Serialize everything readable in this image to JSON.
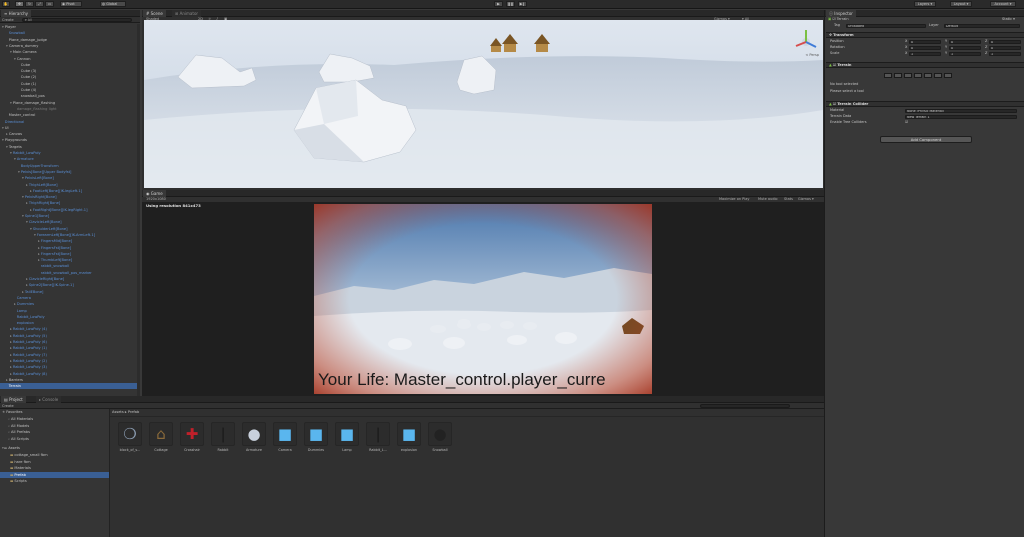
{
  "toolbar": {
    "pivot_label": "Pivot",
    "global_label": "Global",
    "layers_label": "Layers",
    "layout_label": "Layout",
    "account_label": "Account"
  },
  "hierarchy": {
    "tab": "Hierarchy",
    "create_label": "Create",
    "search_label": "▾ All",
    "items": [
      {
        "label": "Player",
        "depth": 0,
        "color": "normal",
        "arrow": "open"
      },
      {
        "label": "Snowball",
        "depth": 1,
        "color": "blue",
        "arrow": ""
      },
      {
        "label": "Plane_damage_judge",
        "depth": 1,
        "color": "normal",
        "arrow": ""
      },
      {
        "label": "Camera_dummy",
        "depth": 1,
        "color": "normal",
        "arrow": "open"
      },
      {
        "label": "Main Camera",
        "depth": 2,
        "color": "normal",
        "arrow": "open"
      },
      {
        "label": "Cannon",
        "depth": 3,
        "color": "normal",
        "arrow": "open"
      },
      {
        "label": "Cube",
        "depth": 4,
        "color": "normal",
        "arrow": ""
      },
      {
        "label": "Cube (3)",
        "depth": 4,
        "color": "normal",
        "arrow": ""
      },
      {
        "label": "Cube (2)",
        "depth": 4,
        "color": "normal",
        "arrow": ""
      },
      {
        "label": "Cube (1)",
        "depth": 4,
        "color": "normal",
        "arrow": ""
      },
      {
        "label": "Cube (4)",
        "depth": 4,
        "color": "normal",
        "arrow": ""
      },
      {
        "label": "snowball_pos",
        "depth": 4,
        "color": "normal",
        "arrow": ""
      },
      {
        "label": "Plane_damage_flashing",
        "depth": 2,
        "color": "normal",
        "arrow": "open"
      },
      {
        "label": "damage_flashing light",
        "depth": 3,
        "color": "gray",
        "arrow": ""
      },
      {
        "label": "Master_control",
        "depth": 1,
        "color": "normal",
        "arrow": ""
      },
      {
        "label": "Directional",
        "depth": 0,
        "color": "blue",
        "arrow": ""
      },
      {
        "label": "UI",
        "depth": 0,
        "color": "normal",
        "arrow": "open"
      },
      {
        "label": "Canvas",
        "depth": 1,
        "color": "normal",
        "arrow": "closed"
      },
      {
        "label": "Playgrounds",
        "depth": 0,
        "color": "normal",
        "arrow": "open"
      },
      {
        "label": "Targets",
        "depth": 1,
        "color": "normal",
        "arrow": "open"
      },
      {
        "label": "Rabbit_LowPoly",
        "depth": 2,
        "color": "blue",
        "arrow": "open"
      },
      {
        "label": "Armature",
        "depth": 3,
        "color": "blue",
        "arrow": "open"
      },
      {
        "label": "BodyUpperTransform",
        "depth": 4,
        "color": "blue",
        "arrow": ""
      },
      {
        "label": "Pelvis[Bone][Upper Bodyfst]",
        "depth": 4,
        "color": "blue",
        "arrow": "open"
      },
      {
        "label": "PelvisLeft[Bone]",
        "depth": 5,
        "color": "blue",
        "arrow": "open"
      },
      {
        "label": "ThighLeft[Bone]",
        "depth": 6,
        "color": "blue",
        "arrow": "closed"
      },
      {
        "label": "FootLeft[Bone][IK-legLeft.1]",
        "depth": 7,
        "color": "blue",
        "arrow": "closed"
      },
      {
        "label": "PelvisRight[Bone]",
        "depth": 5,
        "color": "blue",
        "arrow": "open"
      },
      {
        "label": "ThighRight[Bone]",
        "depth": 6,
        "color": "blue",
        "arrow": "closed"
      },
      {
        "label": "FootRight[Bone][IK-legRight.1]",
        "depth": 7,
        "color": "blue",
        "arrow": "closed"
      },
      {
        "label": "Spine1[Bone]",
        "depth": 5,
        "color": "blue",
        "arrow": "open"
      },
      {
        "label": "ClavicleLeft[Bone]",
        "depth": 6,
        "color": "blue",
        "arrow": "open"
      },
      {
        "label": "ShoulderLeft[Bone]",
        "depth": 7,
        "color": "blue",
        "arrow": "open"
      },
      {
        "label": "ForearmLeft[Bone][IK-ArmLeft.1]",
        "depth": 8,
        "color": "blue",
        "arrow": "open"
      },
      {
        "label": "FingersMid[Bone]",
        "depth": 9,
        "color": "blue",
        "arrow": "closed"
      },
      {
        "label": "FingersFst[Bone]",
        "depth": 9,
        "color": "blue",
        "arrow": "closed"
      },
      {
        "label": "FingersFst[Bone]",
        "depth": 9,
        "color": "blue",
        "arrow": "closed"
      },
      {
        "label": "ThumbLeft[Bone]",
        "depth": 9,
        "color": "blue",
        "arrow": "closed"
      },
      {
        "label": "rabbit_snowball",
        "depth": 9,
        "color": "blue",
        "arrow": ""
      },
      {
        "label": "rabbit_snowball_pos_marker",
        "depth": 9,
        "color": "blue",
        "arrow": ""
      },
      {
        "label": "ClavicleRight[Bone]",
        "depth": 6,
        "color": "blue",
        "arrow": "closed"
      },
      {
        "label": "Spine2[Bone][IK-Spine.1]",
        "depth": 6,
        "color": "blue",
        "arrow": "closed"
      },
      {
        "label": "TailEBone]",
        "depth": 5,
        "color": "blue",
        "arrow": "closed"
      },
      {
        "label": "Camera",
        "depth": 3,
        "color": "blue",
        "arrow": ""
      },
      {
        "label": "Dummies",
        "depth": 3,
        "color": "blue",
        "arrow": "closed"
      },
      {
        "label": "Lamp",
        "depth": 3,
        "color": "blue",
        "arrow": ""
      },
      {
        "label": "Rabbit_LowPoly",
        "depth": 3,
        "color": "blue",
        "arrow": ""
      },
      {
        "label": "explosion",
        "depth": 3,
        "color": "blue",
        "arrow": ""
      },
      {
        "label": "Rabbit_LowPoly (4)",
        "depth": 2,
        "color": "blue",
        "arrow": "closed"
      },
      {
        "label": "Rabbit_LowPoly (5)",
        "depth": 2,
        "color": "blue",
        "arrow": "closed"
      },
      {
        "label": "Rabbit_LowPoly (6)",
        "depth": 2,
        "color": "blue",
        "arrow": "closed"
      },
      {
        "label": "Rabbit_LowPoly (1)",
        "depth": 2,
        "color": "blue",
        "arrow": "closed"
      },
      {
        "label": "Rabbit_LowPoly (7)",
        "depth": 2,
        "color": "blue",
        "arrow": "closed"
      },
      {
        "label": "Rabbit_LowPoly (2)",
        "depth": 2,
        "color": "blue",
        "arrow": "closed"
      },
      {
        "label": "Rabbit_LowPoly (3)",
        "depth": 2,
        "color": "blue",
        "arrow": "closed"
      },
      {
        "label": "Rabbit_LowPoly (8)",
        "depth": 2,
        "color": "blue",
        "arrow": "closed"
      },
      {
        "label": "Barriers",
        "depth": 1,
        "color": "normal",
        "arrow": "closed"
      },
      {
        "label": "Terrain",
        "depth": 1,
        "color": "selected",
        "arrow": ""
      }
    ]
  },
  "scene": {
    "tab": "Scene",
    "animator_tab": "Animator",
    "shading_mode": "Shaded",
    "mode_2d": "2D",
    "gizmos_label": "Gizmos ▾",
    "search_label": "▾ All",
    "persp_label": "< Persp"
  },
  "game": {
    "tab": "Game",
    "display_label": "Display 1 ▾",
    "aspect_label": "1920x1080",
    "maximize_label": "Maximize on Play",
    "mute_label": "Mute audio",
    "stats_label": "Stats",
    "gizmos_label": "Gizmos ▾",
    "resolution_text": "Using resolution 841x473",
    "hud_text": "Your Life: Master_control.player_curre"
  },
  "project": {
    "tab": "Project",
    "console_tab": "Console",
    "create_label": "Create",
    "favorites_label": "Favorites",
    "favorites": [
      "All Materials",
      "All Models",
      "All Prefabs",
      "All Scripts"
    ],
    "assets_label": "Assets",
    "folders": [
      "cottage_small fbm",
      "hare fbm",
      "Materials",
      "Prefab",
      "Scripts"
    ],
    "selected_folder": "Prefab",
    "breadcrumb_root": "Assets",
    "breadcrumb_sep": "▸",
    "breadcrumb_leaf": "Prefab",
    "items": [
      {
        "label": "block_of_s...",
        "icon": "mesh-icon",
        "color": "#8a9bb0"
      },
      {
        "label": "Cottage",
        "icon": "cottage-icon",
        "color": "#8b6a3a"
      },
      {
        "label": "Crosshair",
        "icon": "crosshair-icon",
        "color": "#c0202a"
      },
      {
        "label": "Rabbit",
        "icon": "rabbit-icon",
        "color": "#1a1a1a"
      },
      {
        "label": "Armature",
        "icon": "sphere-icon",
        "color": "#c8d0dc"
      },
      {
        "label": "Camera",
        "icon": "cube-icon",
        "color": "#5ab6ee"
      },
      {
        "label": "Dummies",
        "icon": "cube-icon",
        "color": "#5ab6ee"
      },
      {
        "label": "Lamp",
        "icon": "cube-icon",
        "color": "#5ab6ee"
      },
      {
        "label": "Rabbit_L...",
        "icon": "rabbit-icon",
        "color": "#1a1a1a"
      },
      {
        "label": "explosion",
        "icon": "cube-icon",
        "color": "#5ab6ee"
      },
      {
        "label": "Snowball",
        "icon": "sphere-icon",
        "color": "#222222"
      }
    ]
  },
  "inspector": {
    "tab": "Inspector",
    "object_name": "Terrain",
    "static_label": "Static ▾",
    "tag_label": "Tag",
    "tag_value": "Untagged",
    "layer_label": "Layer",
    "layer_value": "Default",
    "transform_label": "Transform",
    "position_label": "Position",
    "rotation_label": "Rotation",
    "scale_label": "Scale",
    "pos": [
      "0",
      "0",
      "0"
    ],
    "rot": [
      "0",
      "0",
      "0"
    ],
    "scl": [
      "1",
      "1",
      "1"
    ],
    "axis": [
      "X",
      "Y",
      "Z"
    ],
    "terrain_label": "Terrain",
    "no_tool": "No tool selected",
    "select_tool": "Please select a tool",
    "collider_label": "Terrain Collider",
    "material_label": "Material",
    "material_value": "None (Physic Material)",
    "terrain_data_label": "Terrain Data",
    "terrain_data_value": "New Terrain 1",
    "enable_tree_label": "Enable Tree Colliders",
    "add_component": "Add Component"
  },
  "colors": {
    "accent_blue": "#5a8fd6",
    "selection": "#3a5f94",
    "panel_bg": "#383838",
    "vignette": "#b8442a"
  }
}
